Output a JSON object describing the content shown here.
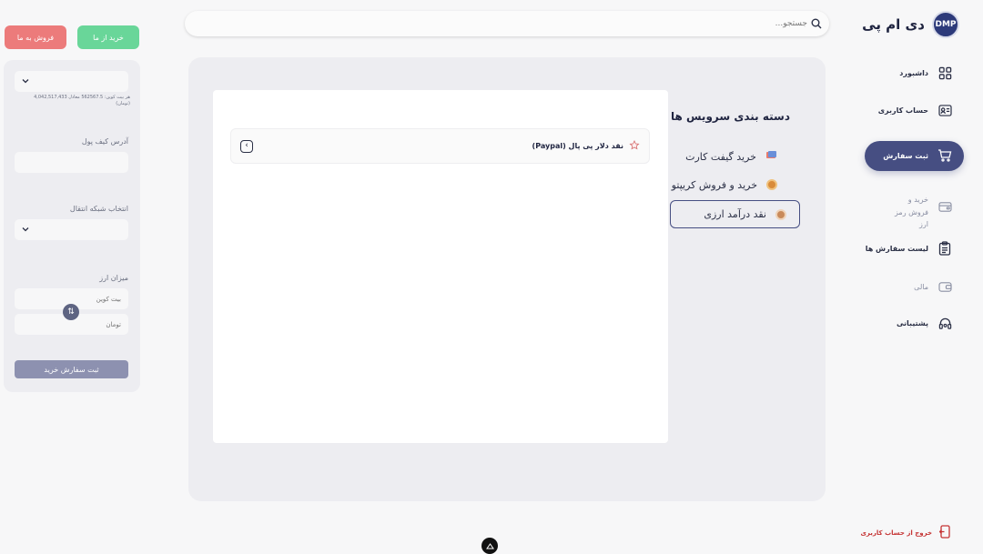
{
  "brand": {
    "name": "دی ام پی",
    "logo_text": "DMP"
  },
  "sidebar": {
    "items": [
      {
        "label": "داشبورد",
        "icon": "grid-icon"
      },
      {
        "label": "حساب کاربری",
        "icon": "id-card-icon"
      },
      {
        "label": "ثبت سفارش",
        "icon": "cart-icon",
        "active": true
      },
      {
        "label": "خرید و فروش رمز ارز",
        "icon": "wallet-card-icon"
      },
      {
        "label": "لیست سفارش ها",
        "icon": "clipboard-icon"
      },
      {
        "label": "مالی",
        "icon": "wallet-icon"
      },
      {
        "label": "پشتیبانی",
        "icon": "headset-icon"
      }
    ],
    "logout_label": "خروج از حساب کاربری"
  },
  "search": {
    "placeholder": "جستجو..."
  },
  "categories": {
    "title": "دسته بندی سرویس ها",
    "items": [
      {
        "label": "خرید گیفت کارت",
        "color": "#e97a6b"
      },
      {
        "label": "خرید و فروش کریپتو",
        "color": "#d98b3a"
      },
      {
        "label": "نقد درآمد ارزی",
        "color": "#c98a5a",
        "active": true
      }
    ]
  },
  "services": [
    {
      "label": "نقد دلار پی پال (Paypal)"
    }
  ],
  "trade": {
    "buy_label": "خرید از ما",
    "sell_label": "فروش به ما",
    "rate_note": "هر بیت کوین: 562567.5 معادل 4,042,517,433 (تومان)",
    "wallet_label": "آدرس کیف پول",
    "network_label": "انتخاب شبکه انتقال",
    "amount_label": "میزان ارز",
    "crypto_placeholder": "بیت کوین",
    "toman_placeholder": "تومان",
    "submit_label": "ثبت سفارش خرید"
  },
  "colors": {
    "accent": "#464e82",
    "buy": "#69d699",
    "sell": "#ec7b7b",
    "logout": "#c53434"
  }
}
